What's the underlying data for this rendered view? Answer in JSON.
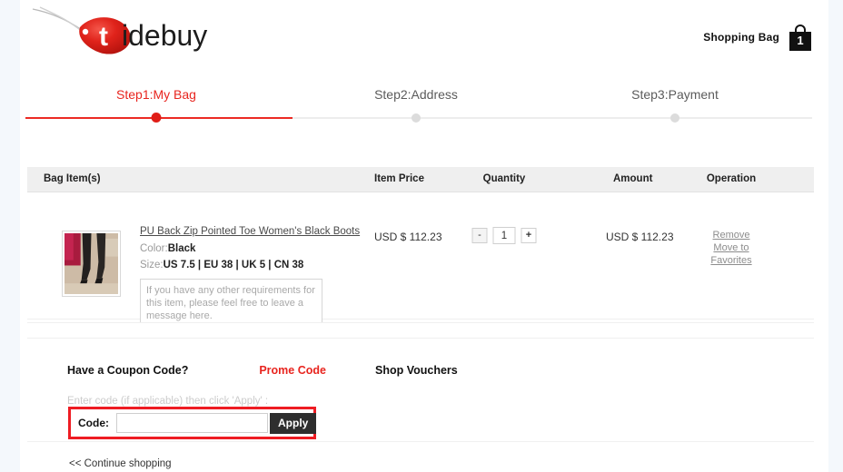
{
  "brand": {
    "name": "tidebuy",
    "logo_letter": "t",
    "accent_color": "#e2231a"
  },
  "header": {
    "shopping_bag_label": "Shopping Bag",
    "bag_count": "1",
    "bag_icon": "shopping-bag-icon"
  },
  "steps": {
    "items": [
      {
        "label": "Step1:My Bag",
        "active": true
      },
      {
        "label": "Step2:Address",
        "active": false
      },
      {
        "label": "Step3:Payment",
        "active": false
      }
    ],
    "active_color": "#e8251f",
    "inactive_color": "#5b5b5b"
  },
  "cart": {
    "headers": {
      "bag_items": "Bag Item(s)",
      "item_price": "Item Price",
      "quantity": "Quantity",
      "amount": "Amount",
      "operation": "Operation"
    },
    "rows": [
      {
        "title": "PU Back Zip Pointed Toe Women's Black Boots",
        "color_label": "Color:",
        "color_value": "Black",
        "size_label": "Size:",
        "size_value": "US 7.5 | EU 38 | UK 5 | CN 38",
        "message_placeholder": "If you have any other requirements for this item, please feel free to leave a message here.",
        "message_value": "",
        "item_price": "USD $ 112.23",
        "quantity": "1",
        "decrement_label": "-",
        "increment_label": "+",
        "amount": "USD $ 112.23",
        "remove_label": "Remove",
        "favorites_label": "Move to Favorites",
        "thumbnail_alt": "black boots product photo"
      }
    ]
  },
  "coupon": {
    "title": "Have a Coupon Code?",
    "promo_tab": "Prome Code",
    "vouchers_tab": "Shop Vouchers",
    "hint": "Enter code (if applicable) then click 'Apply' :",
    "code_label": "Code:",
    "code_value": "",
    "apply_label": "Apply",
    "highlight_color": "#ee1c23"
  },
  "footer": {
    "continue_shopping": "<< Continue shopping"
  }
}
